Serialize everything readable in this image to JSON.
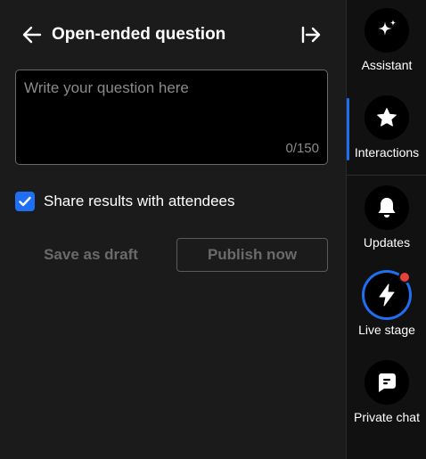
{
  "panel": {
    "title": "Open-ended question",
    "question_placeholder": "Write your question here",
    "question_value": "",
    "char_counter": "0/150",
    "share_results_label": "Share results with attendees",
    "share_results_checked": true,
    "save_draft_label": "Save as draft",
    "publish_label": "Publish now"
  },
  "rail": {
    "items": [
      {
        "label": "Assistant",
        "icon": "sparkle-icon"
      },
      {
        "label": "Interactions",
        "icon": "star-icon",
        "active": true
      },
      {
        "label": "Updates",
        "icon": "bell-icon"
      },
      {
        "label": "Live stage",
        "icon": "lightning-icon",
        "has_notification": true
      },
      {
        "label": "Private chat",
        "icon": "chat-icon"
      }
    ]
  },
  "colors": {
    "accent": "#1f6ff2",
    "notification": "#e5423b",
    "panel_bg": "#1b1b1b",
    "rail_bg": "#111111"
  }
}
